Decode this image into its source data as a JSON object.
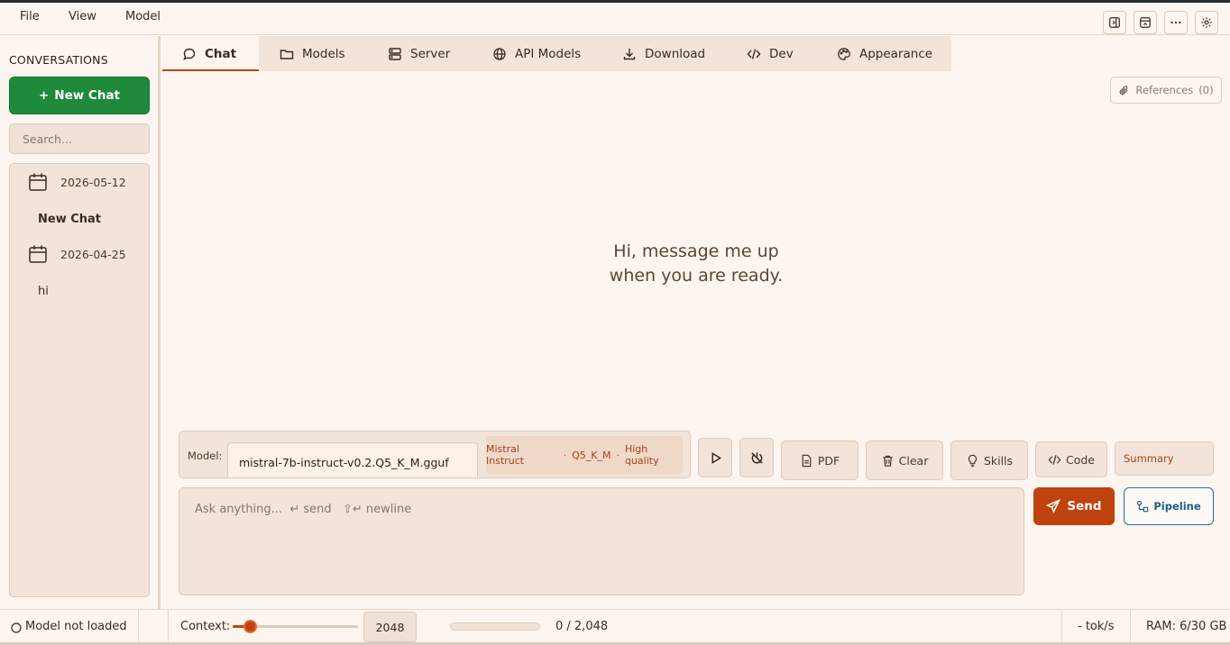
{
  "menu": {
    "items": [
      "File",
      "View",
      "Model"
    ]
  },
  "window_controls": [
    "sidebar-toggle-icon",
    "layout-icon",
    "more-icon",
    "settings-icon"
  ],
  "sidebar": {
    "title": "CONVERSATIONS",
    "new_chat_label": "New Chat",
    "search_placeholder": "Search...",
    "groups": [
      {
        "date": "2026-05-12",
        "items": [
          "New Chat"
        ]
      },
      {
        "date": "2026-04-25",
        "items": [
          "hi"
        ]
      }
    ]
  },
  "tabs": [
    {
      "label": "Chat",
      "icon": "chat-bubble-icon",
      "active": true
    },
    {
      "label": "Models",
      "icon": "folder-icon",
      "active": false
    },
    {
      "label": "Server",
      "icon": "server-icon",
      "active": false
    },
    {
      "label": "API Models",
      "icon": "globe-icon",
      "active": false
    },
    {
      "label": "Download",
      "icon": "download-icon",
      "active": false
    },
    {
      "label": "Dev",
      "icon": "code-icon",
      "active": false
    },
    {
      "label": "Appearance",
      "icon": "palette-icon",
      "active": false
    }
  ],
  "references_label": "References",
  "references_count": "(0)",
  "welcome": {
    "line1": "Hi, message me up",
    "line2": "when you are ready."
  },
  "model": {
    "label": "Model:",
    "selected": "mistral-7b-instruct-v0.2.Q5_K_M.gguf",
    "tags": [
      "Mistral Instruct",
      "Q5_K_M",
      "High quality"
    ],
    "tag_separator": "·"
  },
  "toolbar": {
    "pdf": "PDF",
    "clear": "Clear",
    "skills": "Skills",
    "code": "Code",
    "summary": "Summary"
  },
  "input": {
    "placeholder": "Ask anything...  ↵ send   ⇧↵ newline"
  },
  "send_label": "Send",
  "pipeline_label": "Pipeline",
  "status": {
    "model_state": "Model not loaded",
    "context_label": "Context:",
    "context_value": "2048",
    "context_slider_fraction": 0.1,
    "usage": "0 / 2,048",
    "usage_fraction": 0,
    "tok_rate": "- tok/s",
    "ram": "RAM: 6/30 GB"
  },
  "colors": {
    "accent": "#c0420f",
    "new_chat_green": "#1f8a3b",
    "pipeline_blue": "#1e5f84",
    "background": "#fdf5ef",
    "panel": "#f2e4d8"
  }
}
